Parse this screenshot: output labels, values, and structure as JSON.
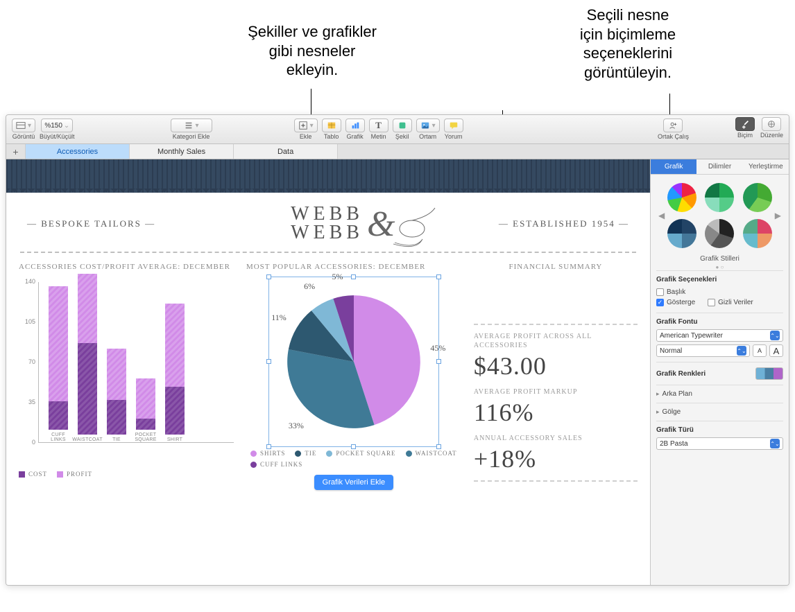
{
  "callouts": {
    "left": "Şekiller ve grafikler\ngibi nesneler\nekleyin.",
    "right": "Seçili nesne\niçin biçimleme\nseçeneklerini\ngörüntüleyin."
  },
  "toolbar": {
    "view_label": "Görüntü",
    "zoom_value": "%150",
    "zoom_label": "Büyüt/Küçült",
    "category_label": "Kategori Ekle",
    "insert_label": "Ekle",
    "table_label": "Tablo",
    "chart_label": "Grafik",
    "text_label": "Metin",
    "shape_label": "Şekil",
    "media_label": "Ortam",
    "comment_label": "Yorum",
    "collaborate_label": "Ortak Çalış",
    "format_label": "Biçim",
    "organize_label": "Düzenle"
  },
  "sheets": {
    "tab1": "Accessories",
    "tab2": "Monthly Sales",
    "tab3": "Data"
  },
  "inspector": {
    "tab_chart": "Grafik",
    "tab_wedges": "Dilimler",
    "tab_arrange": "Yerleştirme",
    "styles_label": "Grafik Stilleri",
    "options_label": "Grafik Seçenekleri",
    "title_check": "Başlık",
    "legend_check": "Gösterge",
    "hidden_check": "Gizli Veriler",
    "font_label": "Grafik Fontu",
    "font_family": "American Typewriter",
    "font_weight": "Normal",
    "colors_label": "Grafik Renkleri",
    "background_label": "Arka Plan",
    "shadow_label": "Gölge",
    "type_label": "Grafik Türü",
    "type_value": "2B Pasta"
  },
  "document": {
    "bespoke": "— BESPOKE TAILORS —",
    "brand1": "WEBB",
    "brand2": "WEBB",
    "established": "— ESTABLISHED 1954 —",
    "bar_title": "ACCESSORIES COST/PROFIT AVERAGE: DECEMBER",
    "pie_title": "MOST POPULAR ACCESSORIES: DECEMBER",
    "fin_title": "FINANCIAL SUMMARY",
    "fin1_label": "AVERAGE PROFIT ACROSS ALL ACCESSORIES",
    "fin1_value": "$43.00",
    "fin2_label": "AVERAGE PROFIT MARKUP",
    "fin2_value": "116%",
    "fin3_label": "ANNUAL ACCESSORY SALES",
    "fin3_value": "+18%",
    "edit_chart_btn": "Grafik Verileri Ekle",
    "bar_legend_cost": "COST",
    "bar_legend_profit": "PROFIT",
    "pie_legend": {
      "shirts": "SHIRTS",
      "tie": "TIE",
      "pocket": "POCKET SQUARE",
      "waist": "WAISTCOAT",
      "cuff": "CUFF LINKS"
    }
  },
  "chart_data": [
    {
      "type": "bar",
      "title": "ACCESSORIES COST/PROFIT AVERAGE: DECEMBER",
      "categories": [
        "CUFF LINKS",
        "WAISTCOAT",
        "TIE",
        "POCKET SQUARE",
        "SHIRT"
      ],
      "series": [
        {
          "name": "COST",
          "values": [
            25,
            80,
            30,
            10,
            42
          ]
        },
        {
          "name": "PROFIT",
          "values": [
            100,
            60,
            45,
            35,
            72
          ]
        }
      ],
      "ylim": [
        0,
        140
      ],
      "yticks": [
        0,
        35,
        70,
        105,
        140
      ],
      "xlabel": "",
      "ylabel": ""
    },
    {
      "type": "pie",
      "title": "MOST POPULAR ACCESSORIES: DECEMBER",
      "labels": [
        "SHIRTS",
        "WAISTCOAT",
        "TIE",
        "POCKET SQUARE",
        "CUFF LINKS"
      ],
      "values": [
        45,
        33,
        11,
        6,
        5
      ],
      "value_suffix": "%"
    }
  ]
}
